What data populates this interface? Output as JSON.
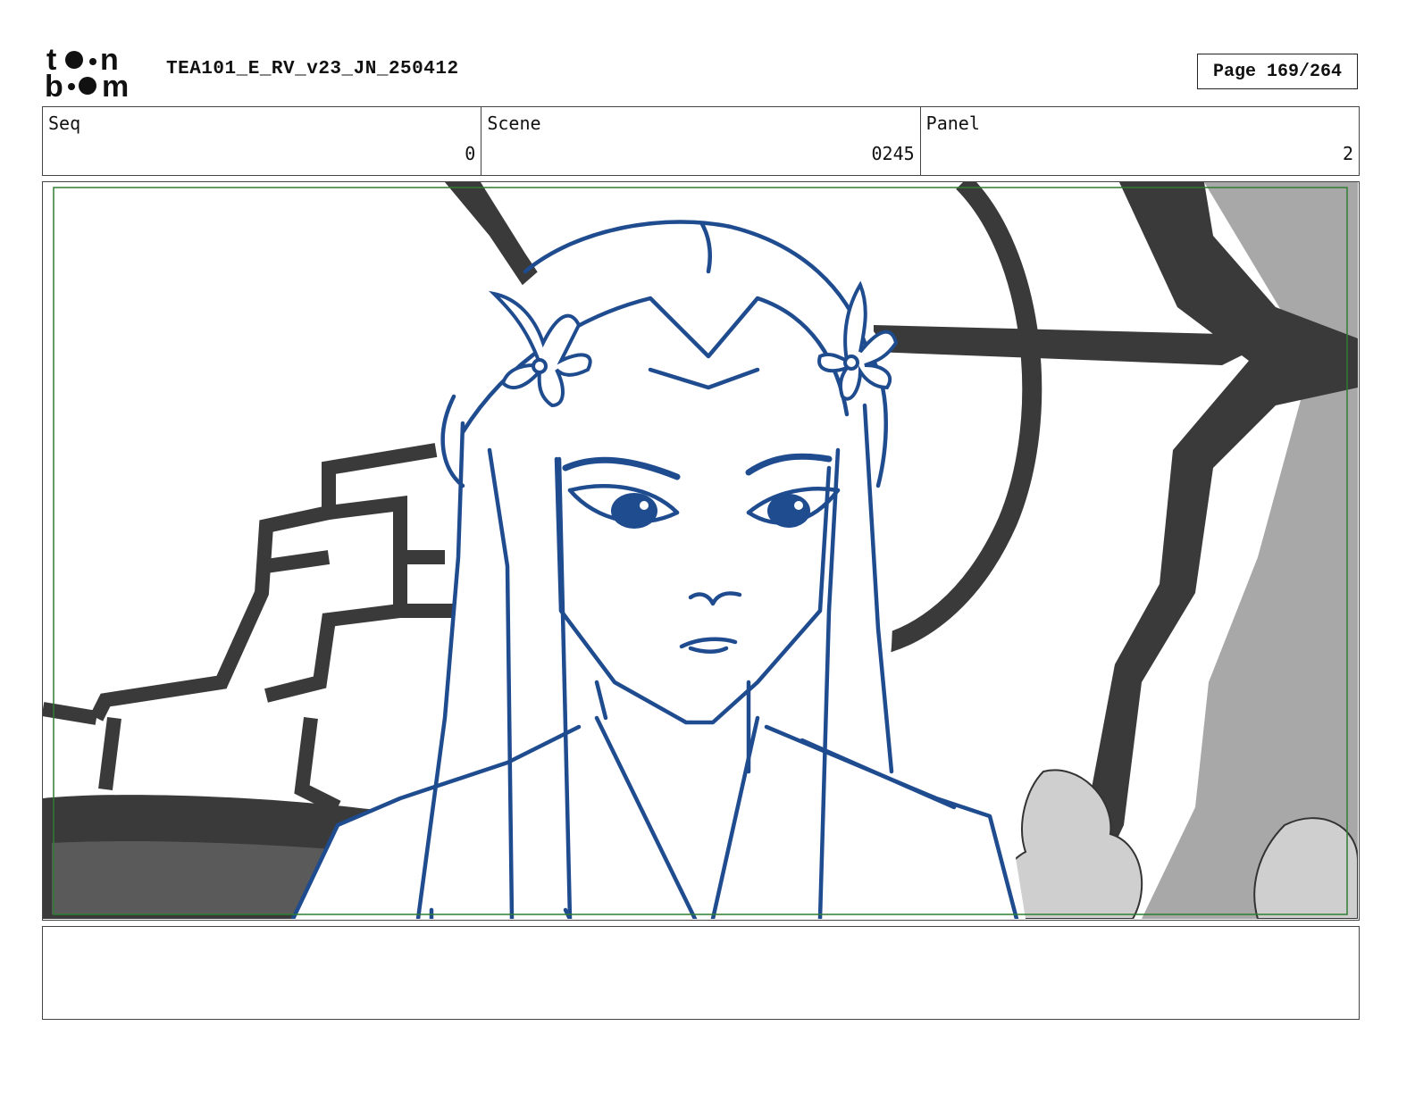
{
  "header": {
    "logo_text": "toon boom",
    "document_title": "TEA101_E_RV_v23_JN_250412",
    "page_label": "Page 169/264"
  },
  "info": {
    "seq_label": "Seq",
    "seq_value": "0",
    "scene_label": "Scene",
    "scene_value": "0245",
    "panel_label": "Panel",
    "panel_value": "2"
  },
  "notes": {
    "text": ""
  },
  "colors": {
    "line_art": "#1f4b8f",
    "background_dark": "#3a3a3a",
    "background_mid": "#a8a8a8",
    "safe_frame": "#2e7d32"
  }
}
